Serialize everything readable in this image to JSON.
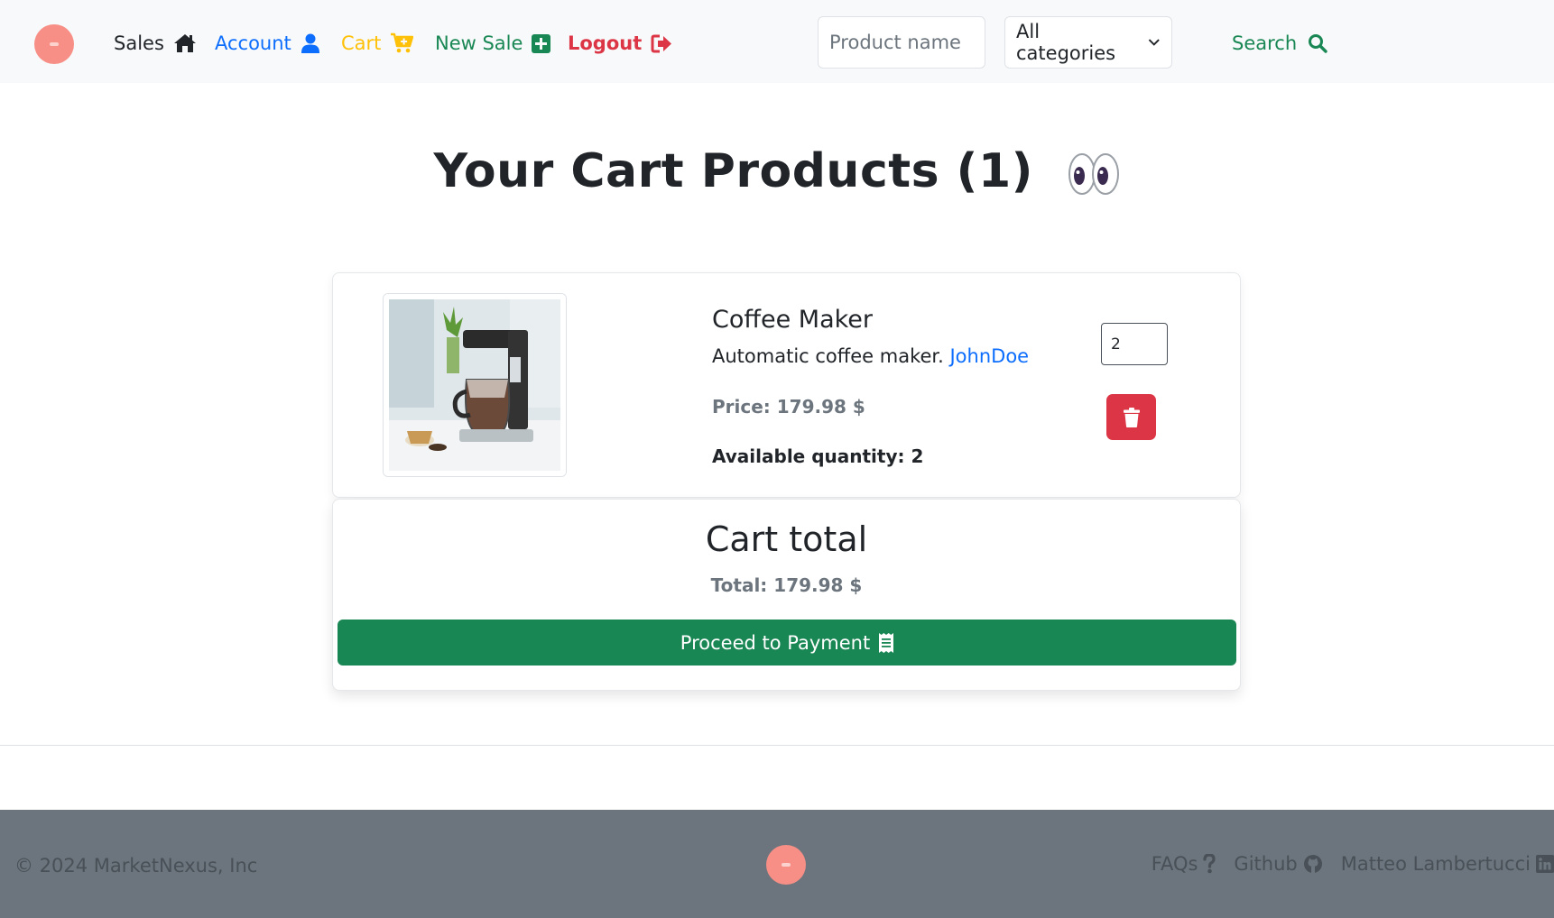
{
  "nav": {
    "sales": "Sales",
    "account": "Account",
    "cart": "Cart",
    "new_sale": "New Sale",
    "logout": "Logout"
  },
  "search": {
    "placeholder": "Product name",
    "category": "All categories",
    "button": "Search"
  },
  "main": {
    "title": "Your Cart Products (1)"
  },
  "cart_item": {
    "name": "Coffee Maker",
    "description": "Automatic coffee maker.",
    "seller": "JohnDoe",
    "price": "Price: 179.98 $",
    "available": "Available quantity: 2",
    "quantity": "2"
  },
  "total": {
    "heading": "Cart total",
    "line": "Total: 179.98 $",
    "pay_button": "Proceed to Payment"
  },
  "footer": {
    "copyright": "© 2024 MarketNexus, Inc",
    "faqs": "FAQs",
    "github": "Github",
    "author": "Matteo Lambertucci"
  },
  "colors": {
    "primary": "#0d6efd",
    "success": "#198754",
    "danger": "#dc3545",
    "warning": "#ffc107",
    "muted": "#6c757d",
    "logo": "#f78f86"
  }
}
